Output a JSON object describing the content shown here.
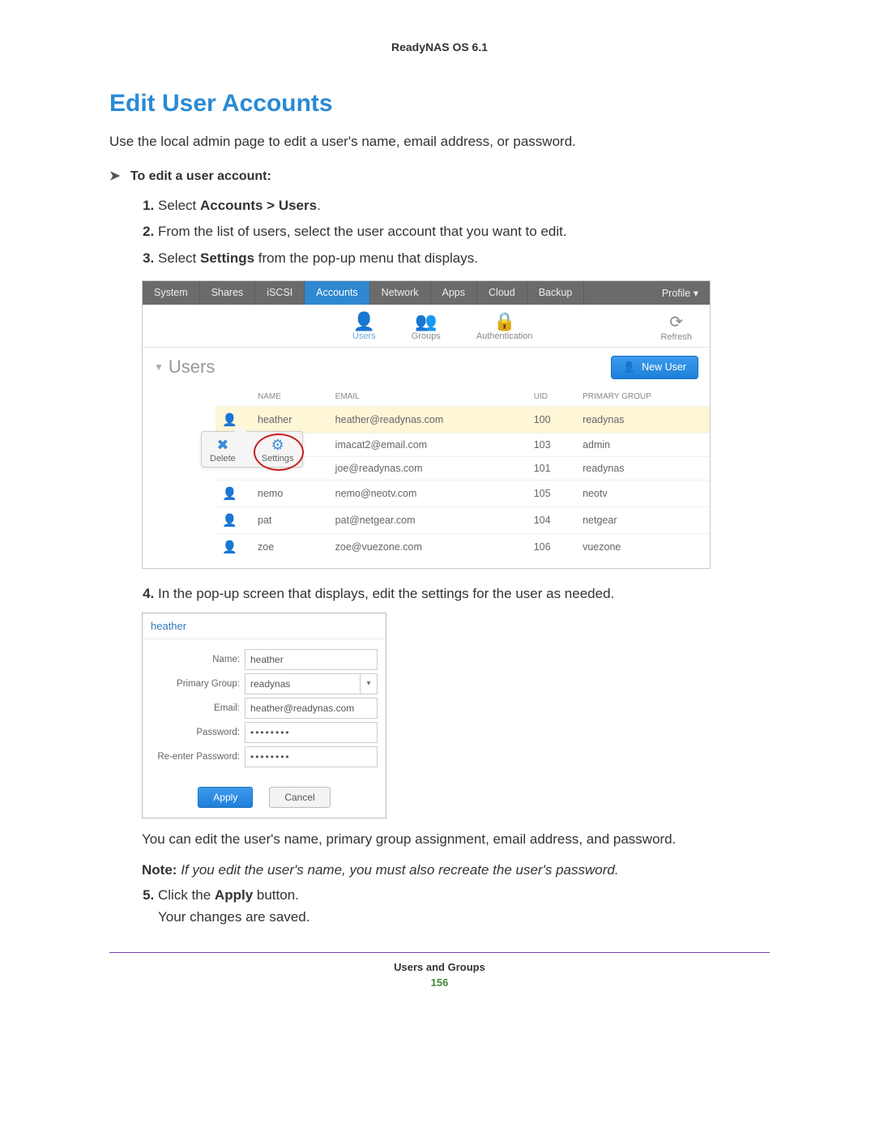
{
  "header": {
    "title": "ReadyNAS OS 6.1"
  },
  "section": {
    "title": "Edit User Accounts"
  },
  "intro": "Use the local admin page to edit a user's name, email address, or password.",
  "task_heading": "To edit a user account:",
  "steps": {
    "s1_pre": "Select ",
    "s1_bold": "Accounts > Users",
    "s1_post": ".",
    "s2": "From the list of users, select the user account that you want to edit.",
    "s3_pre": "Select ",
    "s3_bold": "Settings",
    "s3_post": " from the pop-up menu that displays.",
    "s4": "In the pop-up screen that displays, edit the settings for the user as needed.",
    "s5_pre": "Click the ",
    "s5_bold": "Apply",
    "s5_post": " button.",
    "s5_line2": "Your changes are saved."
  },
  "ss1": {
    "nav": [
      "System",
      "Shares",
      "iSCSI",
      "Accounts",
      "Network",
      "Apps",
      "Cloud",
      "Backup"
    ],
    "nav_active": "Accounts",
    "profile": "Profile ▾",
    "subnav": {
      "users": "Users",
      "groups": "Groups",
      "auth": "Authentication",
      "refresh": "Refresh"
    },
    "panel_title": "Users",
    "new_user": "New User",
    "columns": {
      "name": "NAME",
      "email": "EMAIL",
      "uid": "UID",
      "group": "PRIMARY GROUP"
    },
    "rows": [
      {
        "name": "heather",
        "email": "heather@readynas.com",
        "uid": "100",
        "group": "readynas",
        "highlight": true
      },
      {
        "name": "",
        "email": "imacat2@email.com",
        "uid": "103",
        "group": "admin"
      },
      {
        "name": "",
        "email": "joe@readynas.com",
        "uid": "101",
        "group": "readynas"
      },
      {
        "name": "nemo",
        "email": "nemo@neotv.com",
        "uid": "105",
        "group": "neotv"
      },
      {
        "name": "pat",
        "email": "pat@netgear.com",
        "uid": "104",
        "group": "netgear"
      },
      {
        "name": "zoe",
        "email": "zoe@vuezone.com",
        "uid": "106",
        "group": "vuezone"
      }
    ],
    "popup": {
      "delete": "Delete",
      "settings": "Settings"
    }
  },
  "ss2": {
    "title": "heather",
    "labels": {
      "name": "Name:",
      "group": "Primary Group:",
      "email": "Email:",
      "password": "Password:",
      "repass": "Re-enter Password:"
    },
    "values": {
      "name": "heather",
      "group": "readynas",
      "email": "heather@readynas.com",
      "password": "••••••••",
      "repass": "••••••••"
    },
    "buttons": {
      "apply": "Apply",
      "cancel": "Cancel"
    }
  },
  "posttext": "You can edit the user's name, primary group assignment, email address, and password.",
  "note": {
    "label": "Note:",
    "text": "If you edit the user's name, you must also recreate the user's password."
  },
  "footer": {
    "chapter": "Users and Groups",
    "page": "156"
  }
}
